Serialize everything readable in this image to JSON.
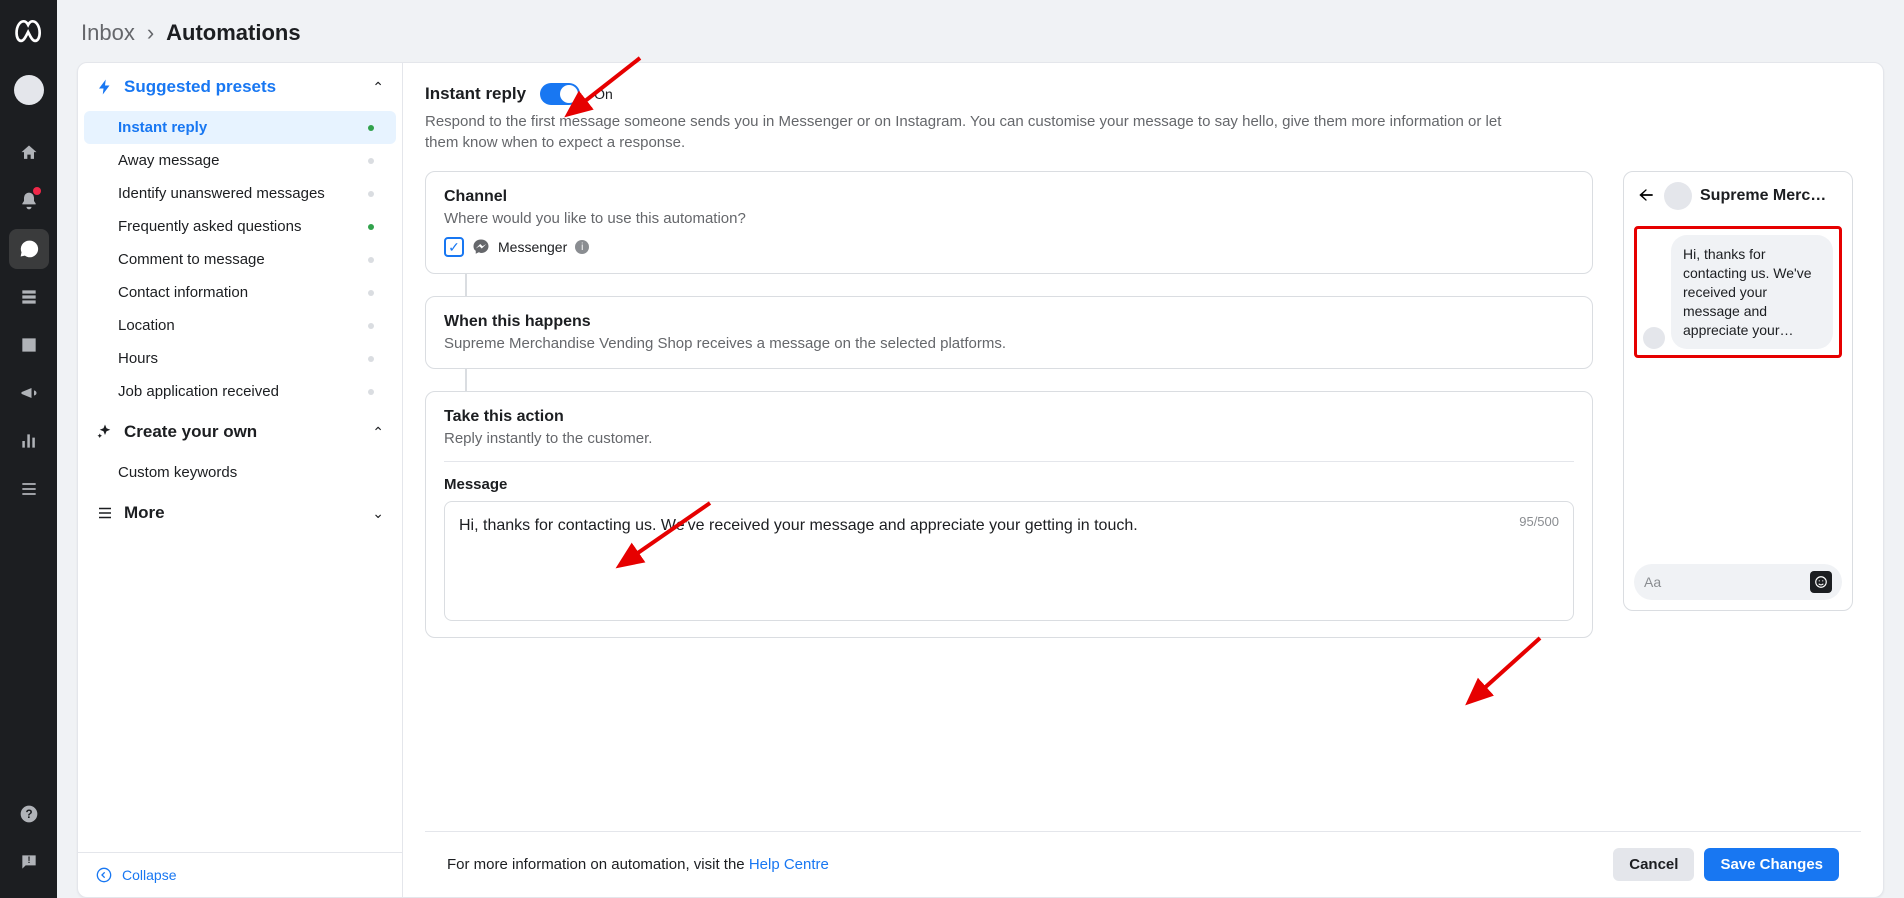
{
  "breadcrumb": {
    "root": "Inbox",
    "current": "Automations"
  },
  "sidebar": {
    "suggested_header": "Suggested presets",
    "items": [
      {
        "label": "Instant reply",
        "active": true,
        "dot": "green"
      },
      {
        "label": "Away message",
        "active": false,
        "dot": "grey"
      },
      {
        "label": "Identify unanswered messages",
        "active": false,
        "dot": "grey"
      },
      {
        "label": "Frequently asked questions",
        "active": false,
        "dot": "green"
      },
      {
        "label": "Comment to message",
        "active": false,
        "dot": "grey"
      },
      {
        "label": "Contact information",
        "active": false,
        "dot": "grey"
      },
      {
        "label": "Location",
        "active": false,
        "dot": "grey"
      },
      {
        "label": "Hours",
        "active": false,
        "dot": "grey"
      },
      {
        "label": "Job application received",
        "active": false,
        "dot": "grey"
      }
    ],
    "create_header": "Create your own",
    "create_items": [
      {
        "label": "Custom keywords"
      }
    ],
    "more": "More",
    "collapse": "Collapse"
  },
  "header": {
    "title": "Instant reply",
    "toggle_state": "On",
    "description": "Respond to the first message someone sends you in Messenger or on Instagram. You can customise your message to say hello, give them more information or let them know when to expect a response."
  },
  "channel": {
    "title": "Channel",
    "subtitle": "Where would you like to use this automation?",
    "option": "Messenger"
  },
  "trigger": {
    "title": "When this happens",
    "subtitle": "Supreme Merchandise Vending Shop receives a message on the selected platforms."
  },
  "action": {
    "title": "Take this action",
    "subtitle": "Reply instantly to the customer.",
    "message_label": "Message",
    "message_text": "Hi, thanks for contacting us. We've received your message and appreciate your getting in touch.",
    "char_count": "95/500"
  },
  "preview": {
    "name": "Supreme Merc…",
    "bubble": "Hi, thanks for contacting us. We've received your message and appreciate your…",
    "placeholder": "Aa"
  },
  "footer": {
    "info_prefix": "For more information on automation, visit the ",
    "link": "Help Centre",
    "cancel": "Cancel",
    "save": "Save Changes"
  }
}
